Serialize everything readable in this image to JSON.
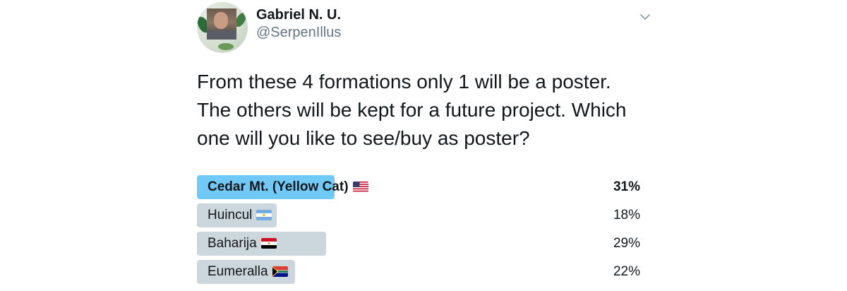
{
  "user": {
    "name": "Gabriel N. U.",
    "handle": "@SerpenIllus"
  },
  "menu_icon": "chevron-down-icon",
  "tweet_text": "From these 4 formations only 1 will be a poster. The others will be kept for a future project. Which one will you like to see/buy as poster?",
  "poll": {
    "choices": [
      {
        "label": "Cedar Mt. (Yellow Cat)",
        "flag": "us-flag-icon",
        "percent": "31%",
        "value": 31,
        "winner": true
      },
      {
        "label": "Huincul",
        "flag": "argentina-flag-icon",
        "percent": "18%",
        "value": 18,
        "winner": false
      },
      {
        "label": "Baharija",
        "flag": "egypt-flag-icon",
        "percent": "29%",
        "value": 29,
        "winner": false
      },
      {
        "label": "Eumeralla",
        "flag": "south-africa-flag-icon",
        "percent": "22%",
        "value": 22,
        "winner": false
      }
    ]
  },
  "colors": {
    "winner_bar": "#71c9f8",
    "bar": "#ccd6dd",
    "handle": "#657786",
    "text": "#14171a"
  }
}
